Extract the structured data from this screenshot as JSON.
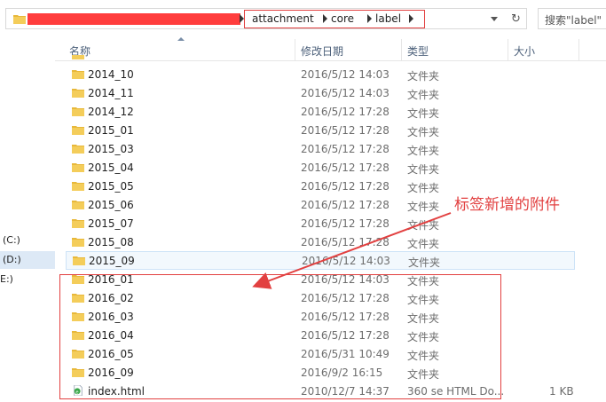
{
  "address": {
    "breadcrumbs": [
      "attachment",
      "core",
      "label"
    ]
  },
  "search": {
    "placeholder": "搜索\"label\""
  },
  "nav": {
    "drives": [
      {
        "label": "(C:)"
      },
      {
        "label": "(D:)"
      },
      {
        "label": "E:)"
      }
    ]
  },
  "columns": {
    "name": "名称",
    "modified": "修改日期",
    "type": "类型",
    "size": "大小"
  },
  "files": [
    {
      "name": "2014_10",
      "date": "2016/5/12 14:03",
      "type": "文件夹",
      "size": ""
    },
    {
      "name": "2014_11",
      "date": "2016/5/12 14:03",
      "type": "文件夹",
      "size": ""
    },
    {
      "name": "2014_12",
      "date": "2016/5/12 17:28",
      "type": "文件夹",
      "size": ""
    },
    {
      "name": "2015_01",
      "date": "2016/5/12 17:28",
      "type": "文件夹",
      "size": ""
    },
    {
      "name": "2015_03",
      "date": "2016/5/12 17:28",
      "type": "文件夹",
      "size": ""
    },
    {
      "name": "2015_04",
      "date": "2016/5/12 17:28",
      "type": "文件夹",
      "size": ""
    },
    {
      "name": "2015_05",
      "date": "2016/5/12 17:28",
      "type": "文件夹",
      "size": ""
    },
    {
      "name": "2015_06",
      "date": "2016/5/12 17:28",
      "type": "文件夹",
      "size": ""
    },
    {
      "name": "2015_07",
      "date": "2016/5/12 17:28",
      "type": "文件夹",
      "size": ""
    },
    {
      "name": "2015_08",
      "date": "2016/5/12 17:28",
      "type": "文件夹",
      "size": ""
    },
    {
      "name": "2015_09",
      "date": "2016/5/12 14:03",
      "type": "文件夹",
      "size": "",
      "selected": true
    },
    {
      "name": "2016_01",
      "date": "2016/5/12 14:03",
      "type": "文件夹",
      "size": ""
    },
    {
      "name": "2016_02",
      "date": "2016/5/12 17:28",
      "type": "文件夹",
      "size": ""
    },
    {
      "name": "2016_03",
      "date": "2016/5/12 17:28",
      "type": "文件夹",
      "size": ""
    },
    {
      "name": "2016_04",
      "date": "2016/5/12 17:28",
      "type": "文件夹",
      "size": ""
    },
    {
      "name": "2016_05",
      "date": "2016/5/31 10:49",
      "type": "文件夹",
      "size": ""
    },
    {
      "name": "2016_09",
      "date": "2016/9/2 16:15",
      "type": "文件夹",
      "size": ""
    },
    {
      "name": "index.html",
      "date": "2010/12/7 14:37",
      "type": "360 se HTML Do...",
      "size": "1 KB",
      "icon": "html-file-icon"
    }
  ],
  "annotation": {
    "callout": "标签新增的附件",
    "color": "#e24040"
  },
  "colors": {
    "folder": "#e8b83a",
    "redaction": "#ff3d3d",
    "selection": "#cde3f7"
  }
}
